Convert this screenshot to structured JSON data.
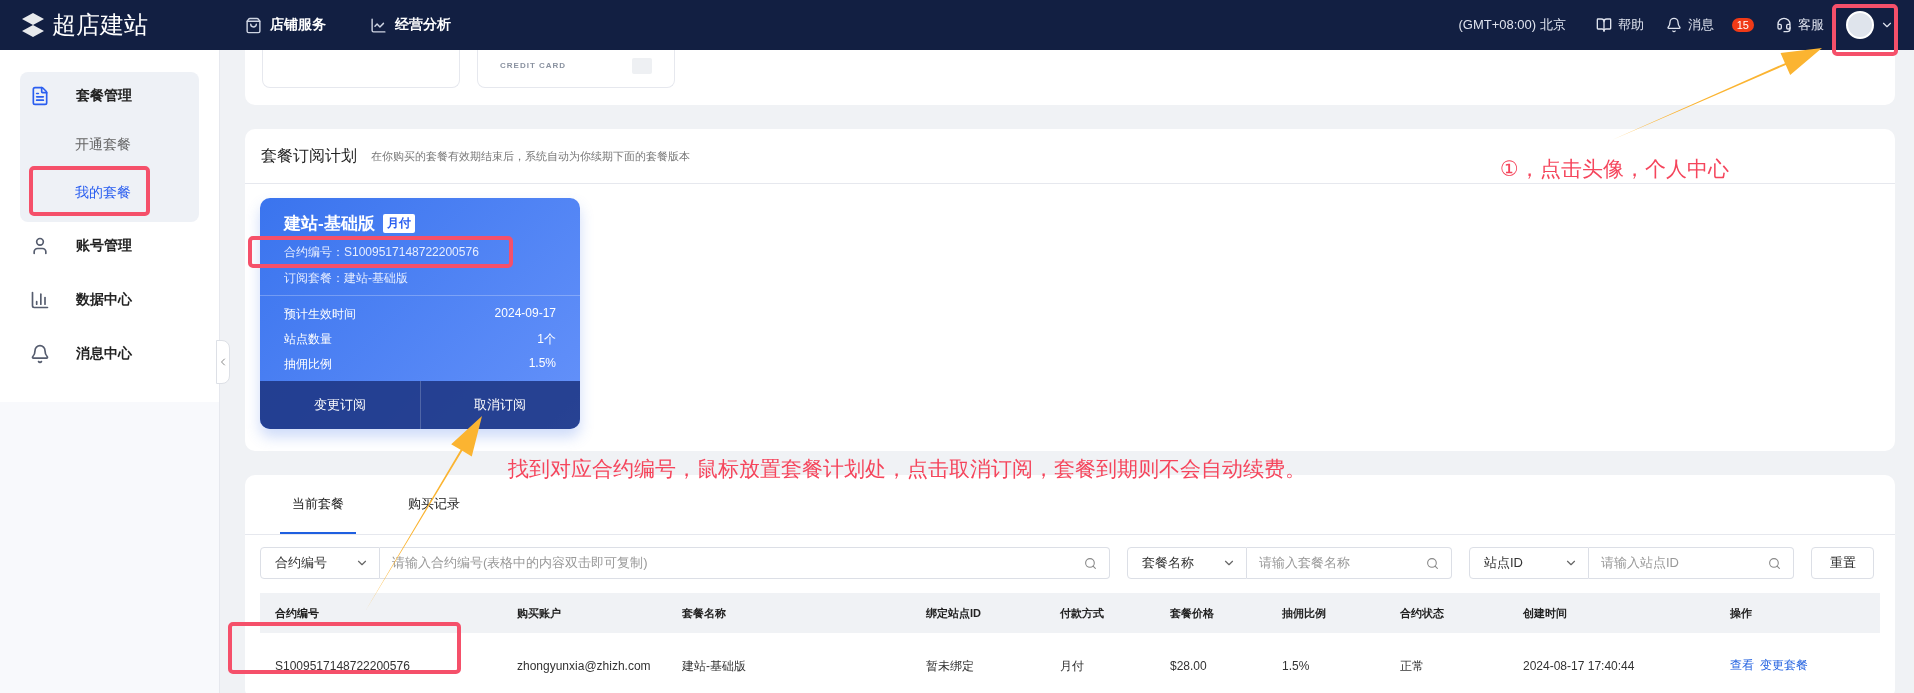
{
  "header": {
    "logo": "超店建站",
    "nav": [
      {
        "label": "店铺服务"
      },
      {
        "label": "经营分析"
      }
    ],
    "timezone": "(GMT+08:00) 北京",
    "help": "帮助",
    "messages": {
      "label": "消息",
      "badge": "15"
    },
    "service": "客服"
  },
  "sidebar": {
    "items": [
      {
        "label": "套餐管理",
        "expanded": true,
        "children": [
          {
            "label": "开通套餐",
            "selected": false
          },
          {
            "label": "我的套餐",
            "selected": true
          }
        ]
      },
      {
        "label": "账号管理",
        "expanded": false
      },
      {
        "label": "数据中心",
        "expanded": false
      },
      {
        "label": "消息中心",
        "expanded": false
      }
    ]
  },
  "top_cards": [
    {
      "kind": "blank"
    },
    {
      "kind": "credit",
      "label": "CREDIT CARD"
    }
  ],
  "subscription": {
    "title": "套餐订阅计划",
    "note": "在你购买的套餐有效期结束后，系统自动为你续期下面的套餐版本",
    "card": {
      "name": "建站-基础版",
      "badge": "月付",
      "contract": "合约编号：S1009517148722200576",
      "plan": "订阅套餐：建站-基础版",
      "rows": [
        {
          "label": "预计生效时间",
          "value": "2024-09-17"
        },
        {
          "label": "站点数量",
          "value": "1个"
        },
        {
          "label": "抽佣比例",
          "value": "1.5%"
        }
      ],
      "actions": [
        "变更订阅",
        "取消订阅"
      ]
    }
  },
  "tabs": [
    {
      "label": "当前套餐",
      "selected": true
    },
    {
      "label": "购买记录",
      "selected": false
    }
  ],
  "filters": [
    {
      "select": "合约编号",
      "placeholder": "请输入合约编号(表格中的内容双击即可复制)"
    },
    {
      "select": "套餐名称",
      "placeholder": "请输入套餐名称"
    },
    {
      "select": "站点ID",
      "placeholder": "请输入站点ID"
    }
  ],
  "reset": "重置",
  "table": {
    "columns": [
      "合约编号",
      "购买账户",
      "套餐名称",
      "绑定站点ID",
      "付款方式",
      "套餐价格",
      "抽佣比例",
      "合约状态",
      "创建时间",
      "操作"
    ],
    "rows": [
      {
        "cells": [
          "S1009517148722200576",
          "zhongyunxia@zhizh.com",
          "建站-基础版",
          "暂未绑定",
          "月付",
          "$28.00",
          "1.5%",
          "正常",
          "2024-08-17 17:40:44"
        ],
        "actions": [
          "查看",
          "变更套餐"
        ]
      }
    ]
  },
  "annotations": [
    {
      "text": "①，点击头像，个人中心"
    },
    {
      "text": "找到对应合约编号，鼠标放置套餐计划处，点击取消订阅，套餐到期则不会自动续费。"
    }
  ]
}
